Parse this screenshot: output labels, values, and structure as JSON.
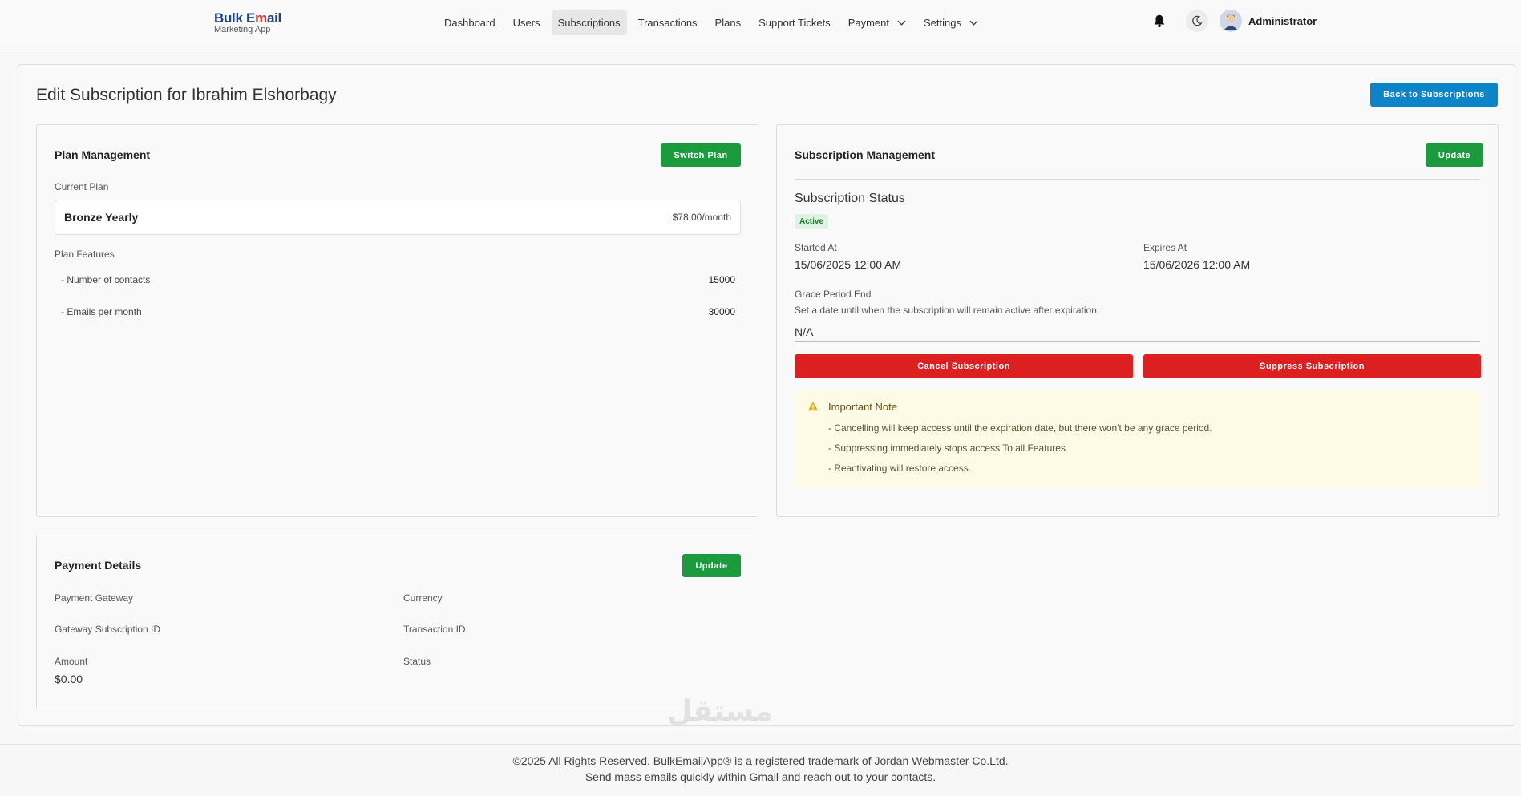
{
  "brand": {
    "line1_a": "Bulk E",
    "line1_m": "m",
    "line1_b": "ail",
    "line2": "Marketing App"
  },
  "nav": {
    "items": [
      {
        "label": "Dashboard"
      },
      {
        "label": "Users"
      },
      {
        "label": "Subscriptions",
        "active": true
      },
      {
        "label": "Transactions"
      },
      {
        "label": "Plans"
      },
      {
        "label": "Support Tickets"
      },
      {
        "label": "Payment",
        "dropdown": true
      },
      {
        "label": "Settings",
        "dropdown": true
      }
    ],
    "user": "Administrator",
    "icons": [
      "bell-icon",
      "moon-icon",
      "avatar"
    ]
  },
  "page": {
    "title": "Edit Subscription for Ibrahim Elshorbagy",
    "back_label": "Back to Subscriptions"
  },
  "plan": {
    "title": "Plan Management",
    "switch_label": "Switch Plan",
    "current_label": "Current Plan",
    "name": "Bronze Yearly",
    "price": "$78.00/month",
    "features_label": "Plan Features",
    "features": [
      {
        "name": "- Number of contacts",
        "value": "15000"
      },
      {
        "name": "- Emails per month",
        "value": "30000"
      }
    ]
  },
  "subscription": {
    "title": "Subscription Management",
    "update_label": "Update",
    "status_title": "Subscription Status",
    "status": "Active",
    "started_label": "Started At",
    "started": "15/06/2025 12:00 AM",
    "expires_label": "Expires At",
    "expires": "15/06/2026 12:00 AM",
    "grace_label": "Grace Period End",
    "grace_help": "Set a date until when the subscription will remain active after expiration.",
    "grace_value": "N/A",
    "cancel_label": "Cancel Subscription",
    "suppress_label": "Suppress Subscription",
    "note_title": "Important Note",
    "note_lines": [
      "- Cancelling will keep access until the expiration date, but there won't be any grace period.",
      "- Suppressing immediately stops access To all Features.",
      "- Reactivating will restore access."
    ]
  },
  "payment": {
    "title": "Payment Details",
    "update_label": "Update",
    "gateway_label": "Payment Gateway",
    "currency_label": "Currency",
    "gateway_sub_label": "Gateway Subscription ID",
    "transaction_label": "Transaction ID",
    "amount_label": "Amount",
    "amount": "$0.00",
    "status_label": "Status"
  },
  "footer": {
    "line1": "©2025 All Rights Reserved. BulkEmailApp® is a registered trademark of Jordan Webmaster Co.Ltd.",
    "line2": "Send mass emails quickly within Gmail and reach out to your contacts."
  },
  "watermark": "مستقل",
  "colors": {
    "primary": "#0b84c8",
    "success": "#1b9b3e",
    "danger": "#dc1f1f",
    "note_bg": "#fdfbe6"
  }
}
